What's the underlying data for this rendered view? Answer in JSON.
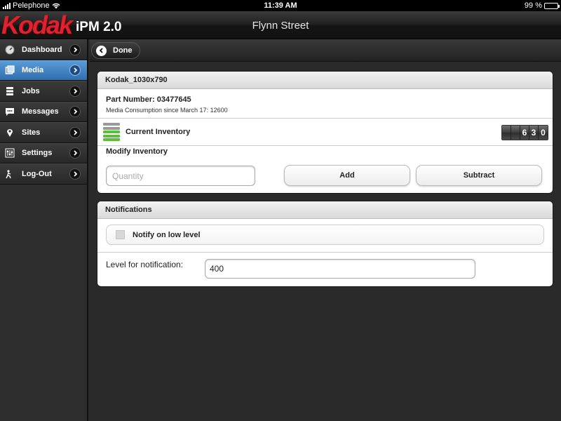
{
  "status_bar": {
    "carrier": "Pelephone",
    "time": "11:39 AM",
    "battery": "99 %",
    "battery_level": 0.99
  },
  "header": {
    "logo_brand": "Kodak",
    "logo_product": "iPM 2.0",
    "title": "Flynn Street"
  },
  "sidebar": {
    "items": [
      {
        "label": "Dashboard",
        "icon": "dashboard-icon",
        "active": false
      },
      {
        "label": "Media",
        "icon": "media-icon",
        "active": true
      },
      {
        "label": "Jobs",
        "icon": "jobs-icon",
        "active": false
      },
      {
        "label": "Messages",
        "icon": "messages-icon",
        "active": false
      },
      {
        "label": "Sites",
        "icon": "sites-icon",
        "active": false
      },
      {
        "label": "Settings",
        "icon": "settings-icon",
        "active": false
      },
      {
        "label": "Log-Out",
        "icon": "logout-icon",
        "active": false
      }
    ]
  },
  "toolbar": {
    "done_label": "Done"
  },
  "media_panel": {
    "title": "Kodak_1030x790",
    "part_number": "Part Number: 03477645",
    "consumption": "Media Consumption since March 17: 12600",
    "inventory_label": "Current Inventory",
    "inventory_digits": [
      "",
      "",
      "6",
      "3",
      "0"
    ],
    "modify_title": "Modify Inventory",
    "quantity_placeholder": "Quantity",
    "add_label": "Add",
    "subtract_label": "Subtract"
  },
  "notifications_panel": {
    "title": "Notifications",
    "notify_label": "Notify on low level",
    "notify_checked": false,
    "level_label": "Level for notification:",
    "level_value": "400"
  },
  "colors": {
    "accent": "#3a7cc0",
    "brand_red": "#e2202f",
    "inventory_green": "#5bbf3a"
  }
}
